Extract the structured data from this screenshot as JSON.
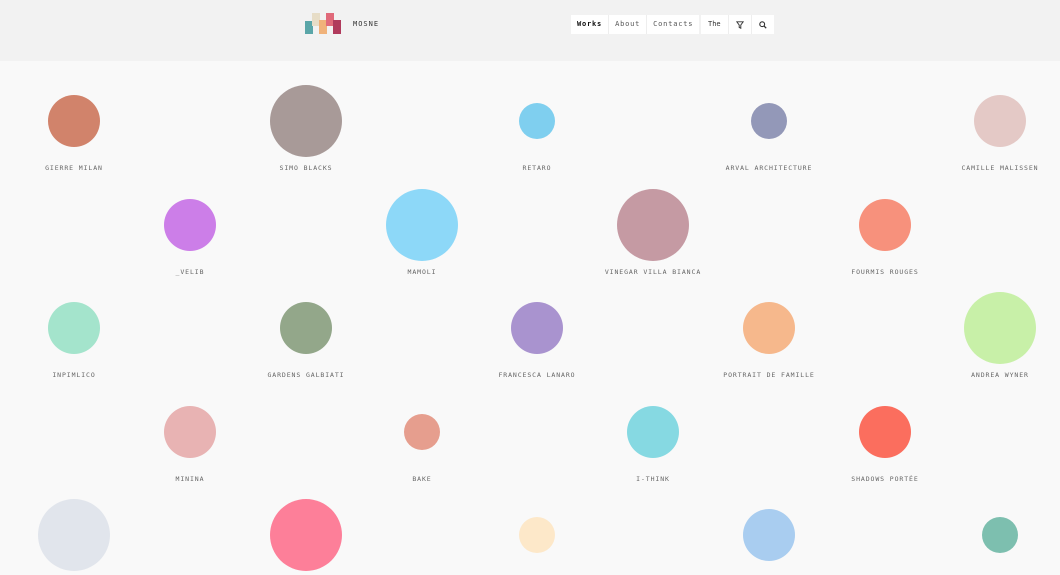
{
  "header": {
    "brand": "MOSNE",
    "nav": [
      {
        "label": "Works",
        "active": true
      },
      {
        "label": "About",
        "active": false
      },
      {
        "label": "Contacts",
        "active": false
      }
    ],
    "language": "The",
    "icons": [
      "filter-icon",
      "search-icon"
    ]
  },
  "logo_colors": [
    "#5aa6a8",
    "#e7ddc7",
    "#f0b27a",
    "#e06a7a",
    "#b03a5c"
  ],
  "works": [
    {
      "name": "GIERRE MILAN",
      "color": "#d1836b",
      "size": "m"
    },
    {
      "name": "SIMO BLACKS",
      "color": "#a89a98",
      "size": "l"
    },
    {
      "name": "RETARO",
      "color": "#7fcfef",
      "size": "s"
    },
    {
      "name": "ARVAL ARCHITECTURE",
      "color": "#9398b8",
      "size": "s"
    },
    {
      "name": "CAMILLE MALISSEN",
      "color": "#e4c9c6",
      "size": "m"
    },
    {
      "name": "_VELIB",
      "color": "#cc7ee8",
      "size": "m"
    },
    {
      "name": "MAMOLI",
      "color": "#8dd8f8",
      "size": "l"
    },
    {
      "name": "VINEGAR VILLA BIANCA",
      "color": "#c59aa3",
      "size": "l"
    },
    {
      "name": "FOURMIS ROUGES",
      "color": "#f7917c",
      "size": "m"
    },
    {
      "name": "INPIMLICO",
      "color": "#a4e4cc",
      "size": "m"
    },
    {
      "name": "GARDENS GALBIATI",
      "color": "#93a78a",
      "size": "m"
    },
    {
      "name": "FRANCESCA LANARO",
      "color": "#a993cf",
      "size": "m"
    },
    {
      "name": "PORTRAIT DE FAMILLE",
      "color": "#f6b88c",
      "size": "m"
    },
    {
      "name": "ANDREA WYNER",
      "color": "#c8f0a8",
      "size": "l"
    },
    {
      "name": "MININA",
      "color": "#e8b3b3",
      "size": "m"
    },
    {
      "name": "BAKE",
      "color": "#e69e8e",
      "size": "s"
    },
    {
      "name": "I-THINK",
      "color": "#86d9e2",
      "size": "m"
    },
    {
      "name": "SHADOWS PORTÉE",
      "color": "#fb6e5e",
      "size": "m"
    },
    {
      "name": "",
      "color": "#e1e5ec",
      "size": "l"
    },
    {
      "name": "",
      "color": "#fd7f99",
      "size": "l"
    },
    {
      "name": "",
      "color": "#fde8c9",
      "size": "s"
    },
    {
      "name": "",
      "color": "#a9cdf0",
      "size": "m"
    },
    {
      "name": "",
      "color": "#7dbfaf",
      "size": "s"
    }
  ]
}
